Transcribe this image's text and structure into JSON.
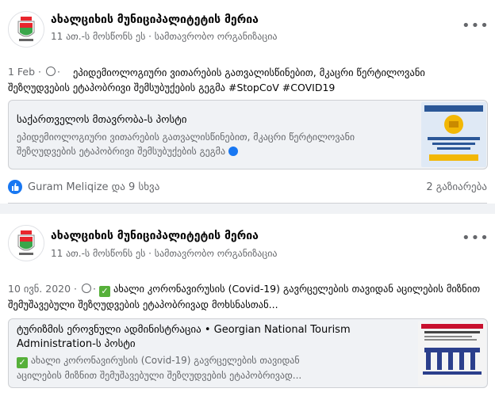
{
  "posts": [
    {
      "page_name": "ახალციხის მუნიციპალიტეტის მერია",
      "meta": "11 ათ.-ს მოსწონს ეს · სამთავრობო ორგანიზაცია",
      "date": "1 Feb ·",
      "text": "ეპიდემიოლოგიური ვითარების გათვალისწინებით, მკაცრი წერტილოვანი შეზღუდვების ეტაპობრივი შემსუბუქების გეგმა #StopCoV #COVID19",
      "shared": {
        "title": "საქართველოს მთავრობა-ს პოსტი",
        "body": "ეპიდემიოლოგიური ვითარების გათვალისწინებით, მკაცრი წერტილოვანი შეზღუდვების ეტაპობრივი შემსუბუქების გეგმა"
      },
      "reactions": "Guram Meliqize და 9 სხვა",
      "shares": "2 გაზიარება"
    },
    {
      "page_name": "ახალციხის მუნიციპალიტეტის მერია",
      "meta": "11 ათ.-ს მოსწონს ეს · სამთავრობო ორგანიზაცია",
      "date": "10 ივნ. 2020 ·",
      "text": "ახალი კორონავირუსის (Covid-19) გავრცელების თავიდან აცილების მიზნით შემუშავებული შეზღუდვების ეტაპობრივად მოხსნასთან...",
      "shared": {
        "title_line1": "ტურიზმის ეროვნული ადმინისტრაცია • Georgian National Tourism",
        "title_line2": "Administration-ს პოსტი",
        "body_line1": "ახალი კორონავირუსის (Covid-19) გავრცელების თავიდან",
        "body_line2": "აცილების მიზნით შემუშავებული შეზღუდვების ეტაპობრივად..."
      }
    }
  ],
  "colors": {
    "accent": "#1877f2",
    "check": "#56b03a",
    "muted": "#65676b"
  }
}
